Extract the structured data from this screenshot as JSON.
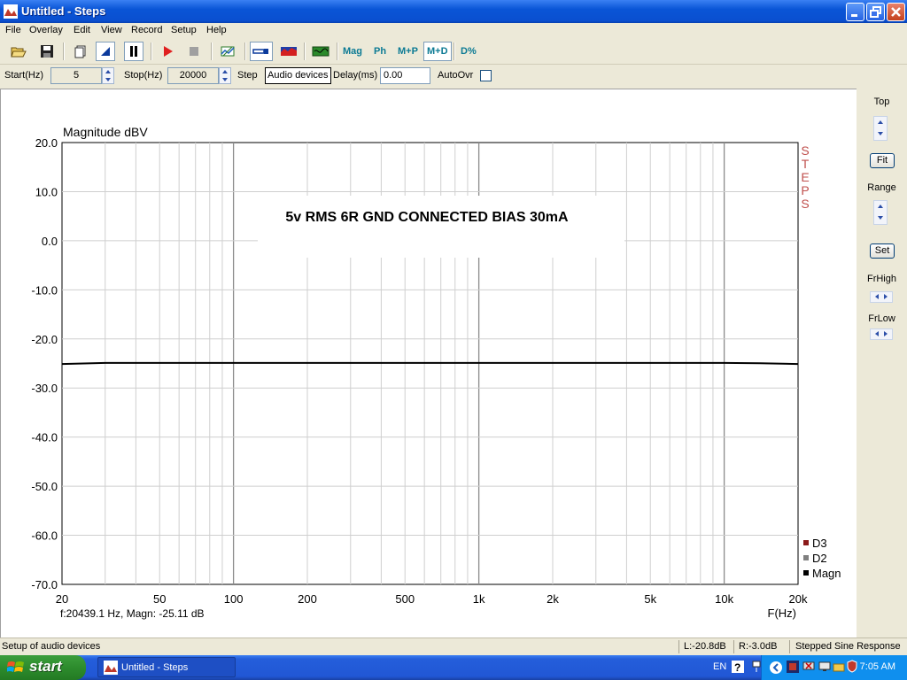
{
  "window": {
    "title": "Untitled - Steps"
  },
  "menu": [
    "File",
    "Overlay",
    "Edit",
    "View",
    "Record",
    "Setup",
    "Help"
  ],
  "toolbar": {
    "icons": [
      "open-icon",
      "save-icon",
      "copy-icon",
      "marker-icon",
      "pause-icon",
      "play-icon",
      "stop-icon",
      "grid-icon",
      "probe-icon",
      "spectrum-icon",
      "scope-icon"
    ],
    "text_buttons": [
      "Mag",
      "Ph",
      "M+P",
      "M+D",
      "D%"
    ],
    "active_view": "M+D"
  },
  "params": {
    "start_label": "Start(Hz)",
    "start_value": "5",
    "stop_label": "Stop(Hz)",
    "stop_value": "20000",
    "step_label": "Step",
    "audio_button": "Audio devices",
    "delay_label": "Delay(ms)",
    "delay_value": "0.00",
    "autoovr_label": "AutoOvr"
  },
  "right_panel": {
    "top_label": "Top",
    "fit_button": "Fit",
    "range_label": "Range",
    "set_button": "Set",
    "frhigh_label": "FrHigh",
    "frlow_label": "FrLow"
  },
  "chart_data": {
    "type": "line",
    "title": "5v RMS 6R GND CONNECTED BIAS 30mA",
    "ylabel": "Magnitude dBV",
    "xlabel": "F(Hz)",
    "xscale": "log",
    "xlim": [
      20,
      20000
    ],
    "ylim": [
      -70,
      20
    ],
    "grid": true,
    "yticks": [
      "20.0",
      "10.0",
      "0.0",
      "-10.0",
      "-20.0",
      "-30.0",
      "-40.0",
      "-50.0",
      "-60.0",
      "-70.0"
    ],
    "xticks": [
      {
        "value": 20,
        "label": "20"
      },
      {
        "value": 50,
        "label": "50"
      },
      {
        "value": 100,
        "label": "100"
      },
      {
        "value": 200,
        "label": "200"
      },
      {
        "value": 500,
        "label": "500"
      },
      {
        "value": 1000,
        "label": "1k"
      },
      {
        "value": 2000,
        "label": "2k"
      },
      {
        "value": 5000,
        "label": "5k"
      },
      {
        "value": 10000,
        "label": "10k"
      },
      {
        "value": 20000,
        "label": "20k"
      }
    ],
    "series": [
      {
        "name": "Magn",
        "color": "#000000",
        "x": [
          20,
          30,
          100,
          1000,
          10000,
          14000,
          20000
        ],
        "y": [
          -25.1,
          -24.9,
          -24.9,
          -24.9,
          -24.9,
          -24.95,
          -25.11
        ]
      }
    ],
    "legend": [
      {
        "name": "D3",
        "color": "#8b1a1a"
      },
      {
        "name": "D2",
        "color": "#808080"
      },
      {
        "name": "Magn",
        "color": "#000000"
      }
    ],
    "legend_position": "bottom-right",
    "watermark": "STEPS",
    "cursor_readout": "f:20439.1 Hz, Magn: -25.11 dB"
  },
  "status": {
    "message": "Setup of audio devices",
    "left_level": "L:-20.8dB",
    "right_level": "R:-3.0dB",
    "mode": "Stepped Sine Response"
  },
  "taskbar": {
    "start_label": "start",
    "task_item": "Untitled - Steps",
    "language": "EN",
    "clock": "7:05 AM"
  }
}
